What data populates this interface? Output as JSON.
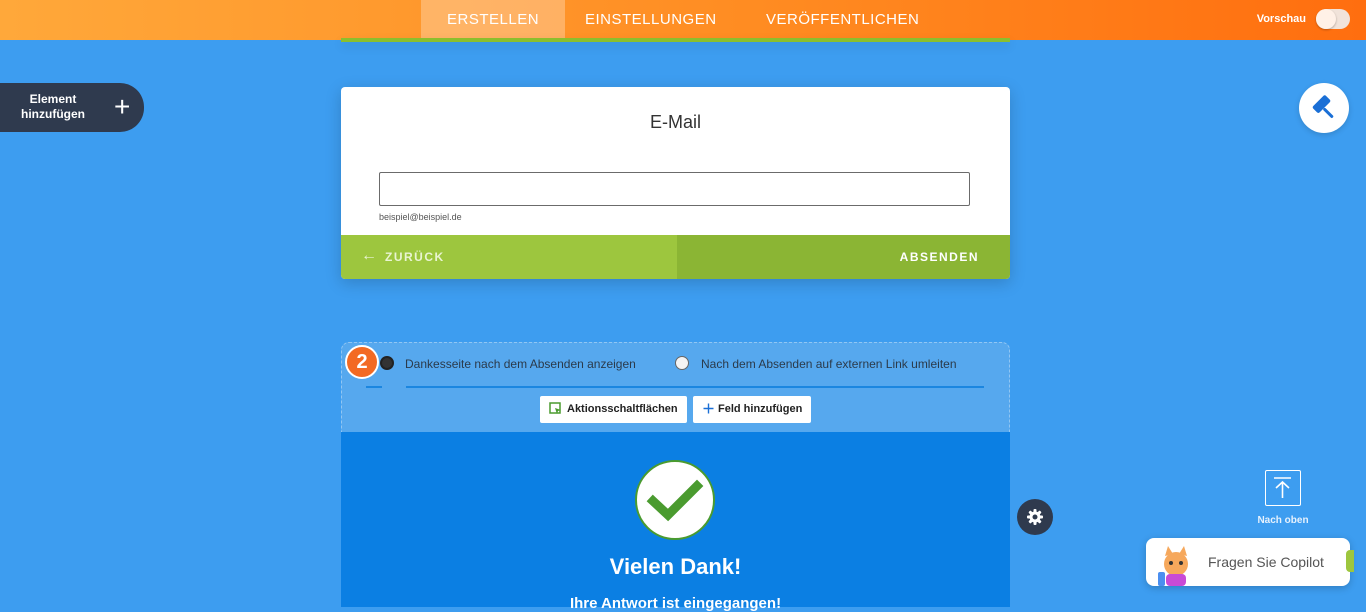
{
  "topbar": {
    "tabs": [
      {
        "label": "ERSTELLEN",
        "active": true
      },
      {
        "label": "EINSTELLUNGEN",
        "active": false
      },
      {
        "label": "VERÖFFENTLICHEN",
        "active": false
      }
    ],
    "preview_label": "Vorschau",
    "preview_on": false
  },
  "sidebar": {
    "add_element_label": "Element hinzufügen",
    "add_element_icon": "plus-icon"
  },
  "designer": {
    "icon": "paint-roller-icon"
  },
  "email_card": {
    "title": "E-Mail",
    "input_value": "",
    "sublabel": "beispiel@beispiel.de",
    "back_label": "ZURÜCK",
    "submit_label": "ABSENDEN"
  },
  "thankyou": {
    "step_number": "2",
    "options": [
      {
        "label": "Dankesseite nach dem Absenden anzeigen",
        "selected": true
      },
      {
        "label": "Nach dem Absenden auf externen Link umleiten",
        "selected": false
      }
    ],
    "buttons": [
      {
        "label": "Aktionsschaltflächen",
        "icon": "action-button-icon"
      },
      {
        "label": "Feld hinzufügen",
        "icon": "plus-icon"
      }
    ],
    "title": "Vielen Dank!",
    "subtitle": "Ihre Antwort ist eingegangen!"
  },
  "floating": {
    "scroll_top_label": "Nach oben",
    "copilot_label": "Fragen Sie Copilot"
  },
  "colors": {
    "background": "#3d9df0",
    "accent_orange": "#ff8c22",
    "green": "#9dc63e",
    "thankyou_blue": "#0b7fe3"
  }
}
